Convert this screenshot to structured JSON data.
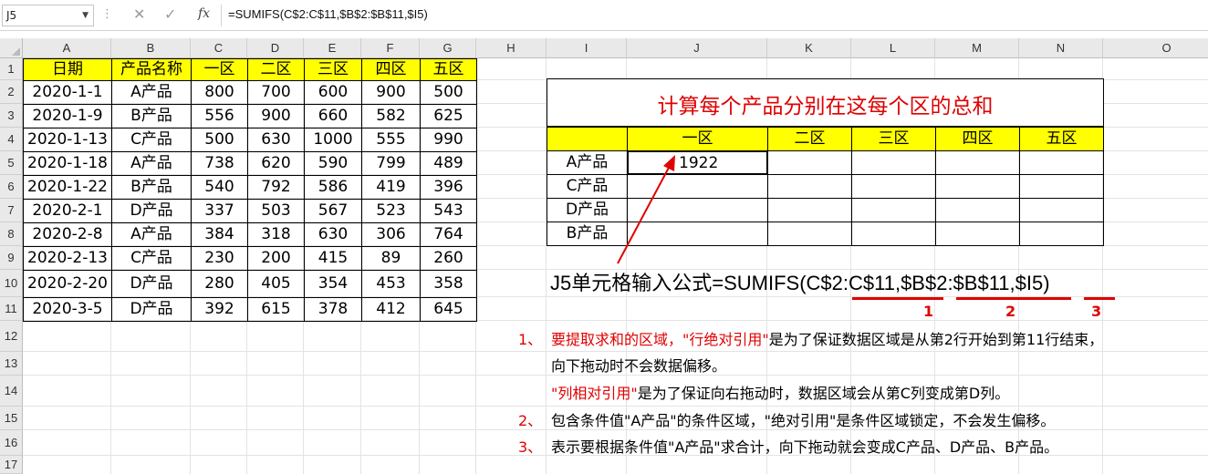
{
  "formula_bar": {
    "name_box": "J5",
    "fx_label": "fx",
    "formula": "=SUMIFS(C$2:C$11,$B$2:$B$11,$I5)"
  },
  "columns": [
    "A",
    "B",
    "C",
    "D",
    "E",
    "F",
    "G",
    "H",
    "I",
    "J",
    "K",
    "L",
    "M",
    "N",
    "O"
  ],
  "rows": [
    "1",
    "2",
    "3",
    "4",
    "5",
    "6",
    "7",
    "8",
    "9",
    "10",
    "11",
    "12",
    "13",
    "14",
    "15",
    "16",
    "17"
  ],
  "source_table": {
    "headers": [
      "日期",
      "产品名称",
      "一区",
      "二区",
      "三区",
      "四区",
      "五区"
    ],
    "rows": [
      [
        "2020-1-1",
        "A产品",
        "800",
        "700",
        "600",
        "900",
        "500"
      ],
      [
        "2020-1-9",
        "B产品",
        "556",
        "900",
        "660",
        "582",
        "625"
      ],
      [
        "2020-1-13",
        "C产品",
        "500",
        "630",
        "1000",
        "555",
        "990"
      ],
      [
        "2020-1-18",
        "A产品",
        "738",
        "620",
        "590",
        "799",
        "489"
      ],
      [
        "2020-1-22",
        "B产品",
        "540",
        "792",
        "586",
        "419",
        "396"
      ],
      [
        "2020-2-1",
        "D产品",
        "337",
        "503",
        "567",
        "523",
        "543"
      ],
      [
        "2020-2-8",
        "A产品",
        "384",
        "318",
        "630",
        "306",
        "764"
      ],
      [
        "2020-2-13",
        "C产品",
        "230",
        "200",
        "415",
        "89",
        "260"
      ],
      [
        "2020-2-20",
        "D产品",
        "280",
        "405",
        "354",
        "453",
        "358"
      ],
      [
        "2020-3-5",
        "D产品",
        "392",
        "615",
        "378",
        "412",
        "645"
      ]
    ]
  },
  "summary_table": {
    "title": "计算每个产品分别在这每个区的总和",
    "headers": [
      "",
      "一区",
      "二区",
      "三区",
      "四区",
      "五区"
    ],
    "products": [
      "A产品",
      "C产品",
      "D产品",
      "B产品"
    ],
    "j5_value": "1922"
  },
  "annotation": {
    "formula_text": "J5单元格输入公式=SUMIFS(C$2:C$11,$B$2:$B$11,$I5)",
    "markers": [
      "1",
      "2",
      "3"
    ]
  },
  "notes": {
    "n1_num": "1、",
    "n1_a": "要提取求和的区域，",
    "n1_b": "\"行绝对引用\"",
    "n1_c": "是为了保证数据区域是从第2行开始到第11行结束，",
    "n1_line2": "向下拖动时不会数据偏移。",
    "n1_d": "\"列相对引用\"",
    "n1_e": "是为了保证向右拖动时，数据区域会从第C列变成第D列。",
    "n2_num": "2、",
    "n2_text": "包含条件值\"A产品\"的条件区域，\"绝对引用\"是条件区域锁定，不会发生偏移。",
    "n3_num": "3、",
    "n3_text": "表示要根据条件值\"A产品\"求合计，向下拖动就会变成C产品、D产品、B产品。"
  },
  "colors": {
    "header_fill": "#ffff00",
    "accent_red": "#e00000"
  }
}
